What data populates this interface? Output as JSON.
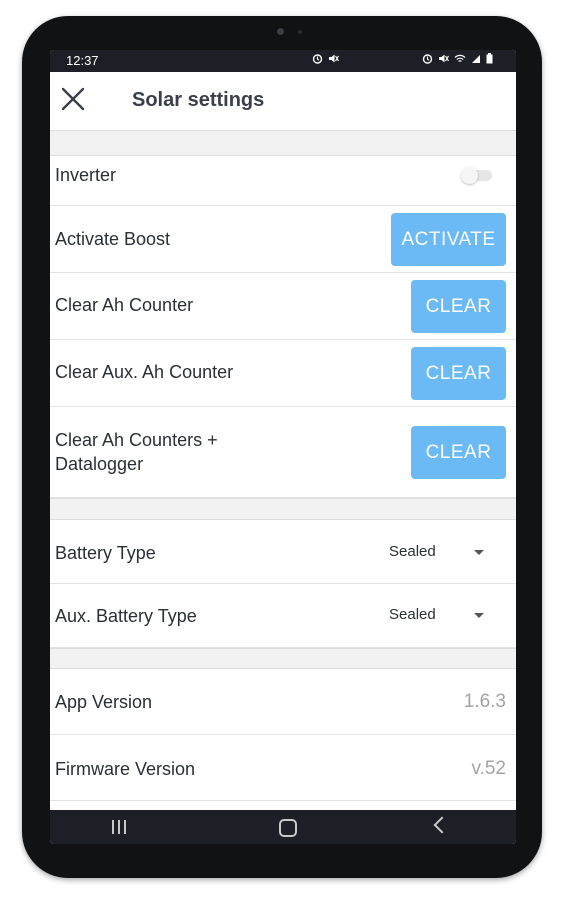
{
  "status_bar": {
    "time": "12:37",
    "mid_icons": [
      "alarm-icon",
      "mute-icon"
    ],
    "right_icons": [
      "alarm-icon",
      "mute-icon",
      "wifi-icon",
      "signal-icon",
      "battery-icon"
    ]
  },
  "header": {
    "title": "Solar settings",
    "close_icon": "close-icon"
  },
  "settings": {
    "inverter": {
      "label": "Inverter",
      "enabled": false
    },
    "activate_boost": {
      "label": "Activate Boost",
      "button": "ACTIVATE"
    },
    "clear_ah": {
      "label": "Clear Ah Counter",
      "button": "CLEAR"
    },
    "clear_aux_ah": {
      "label": "Clear Aux. Ah Counter",
      "button": "CLEAR"
    },
    "clear_all": {
      "label_line1": "Clear Ah Counters +",
      "label_line2": "Datalogger",
      "button": "CLEAR"
    }
  },
  "battery": {
    "battery_type": {
      "label": "Battery Type",
      "value": "Sealed"
    },
    "aux_battery_type": {
      "label": "Aux. Battery Type",
      "value": "Sealed"
    }
  },
  "info": {
    "app_version": {
      "label": "App Version",
      "value": "1.6.3"
    },
    "firmware_version": {
      "label": "Firmware Version",
      "value": "v.52"
    }
  },
  "nav_bar": {
    "icons": [
      "recent-apps-icon",
      "home-icon",
      "back-icon"
    ]
  },
  "colors": {
    "accent": "#6bb9f5",
    "status_bar": "#1c1f26",
    "device_frame": "#111214"
  }
}
